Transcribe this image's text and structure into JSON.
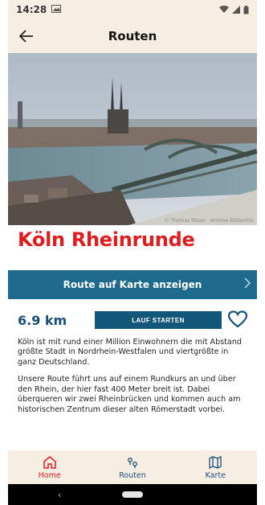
{
  "status_bar": {
    "time": "14:28"
  },
  "app_bar": {
    "title": "Routen"
  },
  "hero": {
    "credit": "© Thomas Rösen · Archive Bildarchiv"
  },
  "route": {
    "title": "Köln Rheinrunde",
    "map_button": "Route auf Karte anzeigen",
    "distance": "6.9 km",
    "start_button": "LAUF STARTEN",
    "description": [
      "Köln ist mit rund einer Million Einwohnern die mit Abstand größte Stadt in Nordrhein-Westfalen und viertgrößte in ganz Deutschland.",
      "Unsere Route führt uns auf einem Rundkurs an und über den Rhein, der hier fast 400 Meter breit ist. Dabei überqueren wir zwei Rheinbrücken und kommen auch am historischen Zentrum dieser alten Römerstadt vorbei."
    ]
  },
  "bottom_nav": {
    "items": [
      {
        "label": "Home",
        "icon": "home-icon",
        "active": true
      },
      {
        "label": "Routen",
        "icon": "route-pins-icon",
        "active": false
      },
      {
        "label": "Karte",
        "icon": "map-icon",
        "active": false
      }
    ]
  },
  "colors": {
    "accent_red": "#e11c1c",
    "primary_blue": "#1e6a8c",
    "dark_blue": "#12567a",
    "cream": "#f6eee3"
  }
}
